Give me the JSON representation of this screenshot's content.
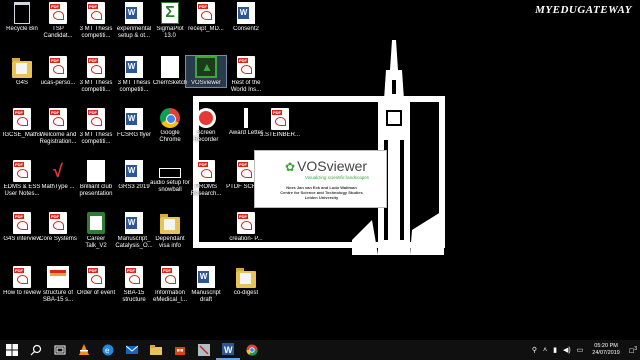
{
  "watermark": "MYEDUGATEWAY",
  "desktop_icons": [
    {
      "label": "Recycle Bin",
      "glyph": "recycle-bin-icon",
      "col": 0,
      "row": 0
    },
    {
      "label": "TSP Candidat...",
      "glyph": "pdf-icon",
      "col": 1,
      "row": 0
    },
    {
      "label": "3 MT Thesis competiti...",
      "glyph": "pdf-icon",
      "col": 2,
      "row": 0
    },
    {
      "label": "experimental setup & ot...",
      "glyph": "word-icon",
      "col": 3,
      "row": 0
    },
    {
      "label": "SigmaPlot 13.0",
      "glyph": "sigmaplot-icon",
      "col": 4,
      "row": 0
    },
    {
      "label": "receipt_MD...",
      "glyph": "pdf-icon",
      "col": 5,
      "row": 0
    },
    {
      "label": "Consent2",
      "glyph": "word-icon",
      "col": 6,
      "row": 0
    },
    {
      "label": "G4S",
      "glyph": "folder-icon",
      "col": 0,
      "row": 1
    },
    {
      "label": "ucas-perso...",
      "glyph": "pdf-icon",
      "col": 1,
      "row": 1
    },
    {
      "label": "3 MT Thesis competiti...",
      "glyph": "pdf-icon",
      "col": 2,
      "row": 1
    },
    {
      "label": "3 MT Thesis competiti...",
      "glyph": "word-icon",
      "col": 3,
      "row": 1
    },
    {
      "label": "ChemSketch",
      "glyph": "chemsketch-icon",
      "col": 4,
      "row": 1
    },
    {
      "label": "VOSviewer",
      "glyph": "vosviewer-icon",
      "col": 5,
      "row": 1,
      "selected": true
    },
    {
      "label": "Rest of the World Ins...",
      "glyph": "pdf-icon",
      "col": 6,
      "row": 1
    },
    {
      "label": "IGCSE_Maths",
      "glyph": "pdf-icon",
      "col": 0,
      "row": 2
    },
    {
      "label": "Welcome and Registration...",
      "glyph": "pdf-icon",
      "col": 1,
      "row": 2
    },
    {
      "label": "3 MT Thesis competiti...",
      "glyph": "pdf-icon",
      "col": 2,
      "row": 2
    },
    {
      "label": "FCSRG flyer",
      "glyph": "word-icon",
      "col": 3,
      "row": 2
    },
    {
      "label": "Google Chrome",
      "glyph": "chrome-icon",
      "col": 4,
      "row": 2
    },
    {
      "label": "Screen Recorder",
      "glyph": "screen-recorder-icon",
      "col": 5,
      "row": 2
    },
    {
      "label": "Award Letter",
      "glyph": "document-icon",
      "col": 6,
      "row": 2
    },
    {
      "label": "3.STEINBER...",
      "glyph": "pdf-icon",
      "col": 7,
      "row": 2
    },
    {
      "label": "EDMS & ESS User Notes...",
      "glyph": "pdf-icon",
      "col": 0,
      "row": 3
    },
    {
      "label": "MathType ...",
      "glyph": "mathtype-icon",
      "col": 1,
      "row": 3
    },
    {
      "label": "Brilliant club presentation",
      "glyph": "presentation-icon",
      "col": 2,
      "row": 3
    },
    {
      "label": "GRS3 2019",
      "glyph": "word-icon",
      "col": 3,
      "row": 3
    },
    {
      "label": "audio setup for snowball",
      "glyph": "video-icon",
      "col": 4,
      "row": 3
    },
    {
      "label": "PROMS Research...",
      "glyph": "pdf-icon",
      "col": 5,
      "row": 3
    },
    {
      "label": "PTDF SCHO...",
      "glyph": "pdf-icon",
      "col": 6,
      "row": 3
    },
    {
      "label": "G4S interview",
      "glyph": "pdf-icon",
      "col": 0,
      "row": 4
    },
    {
      "label": "Core Systems",
      "glyph": "pdf-icon",
      "col": 1,
      "row": 4
    },
    {
      "label": "Career Talk_V2",
      "glyph": "green-doc-icon",
      "col": 2,
      "row": 4
    },
    {
      "label": "Manuscript_ Catalysis_O...",
      "glyph": "word-icon",
      "col": 3,
      "row": 4
    },
    {
      "label": "Dependant visa info",
      "glyph": "folder-icon",
      "col": 4,
      "row": 4
    },
    {
      "label": "creation- P...",
      "glyph": "pdf-icon",
      "col": 6,
      "row": 4
    },
    {
      "label": "How to review",
      "glyph": "pdf-icon",
      "col": 0,
      "row": 5
    },
    {
      "label": "structure of SBA-15 s...",
      "glyph": "thumb-icon",
      "col": 1,
      "row": 5
    },
    {
      "label": "Order of event",
      "glyph": "pdf-icon",
      "col": 2,
      "row": 5
    },
    {
      "label": "SBA-15 structure",
      "glyph": "pdf-icon",
      "col": 3,
      "row": 5
    },
    {
      "label": "Information eMedical_I...",
      "glyph": "pdf-icon",
      "col": 4,
      "row": 5
    },
    {
      "label": "Manuscript draft",
      "glyph": "word-icon",
      "col": 5,
      "row": 5
    },
    {
      "label": "co-digest",
      "glyph": "folder-icon",
      "col": 6,
      "row": 5
    }
  ],
  "splash": {
    "logo_text": "VOSviewer",
    "subtitle": "Visualizing scientific landscapes",
    "credit_line_1": "Nees Jan van Eck and Ludo Waltman",
    "credit_line_2": "Centre for Science and Technology Studies",
    "credit_line_3": "Leiden University"
  },
  "taskbar": {
    "clock_time": "05:20 PM",
    "clock_date": "24/07/2019",
    "notification_count": "3",
    "pinned": [
      "windows-start-icon",
      "search-icon",
      "task-view-icon",
      "vlc-icon",
      "edge-icon",
      "mail-icon",
      "file-explorer-icon",
      "store-icon",
      "snip-icon",
      "word-icon",
      "chrome-icon"
    ]
  },
  "colors": {
    "pdf_red": "#d8281e",
    "word_blue": "#2b5797",
    "vos_green": "#3ca63c",
    "taskbar": "#101010"
  }
}
